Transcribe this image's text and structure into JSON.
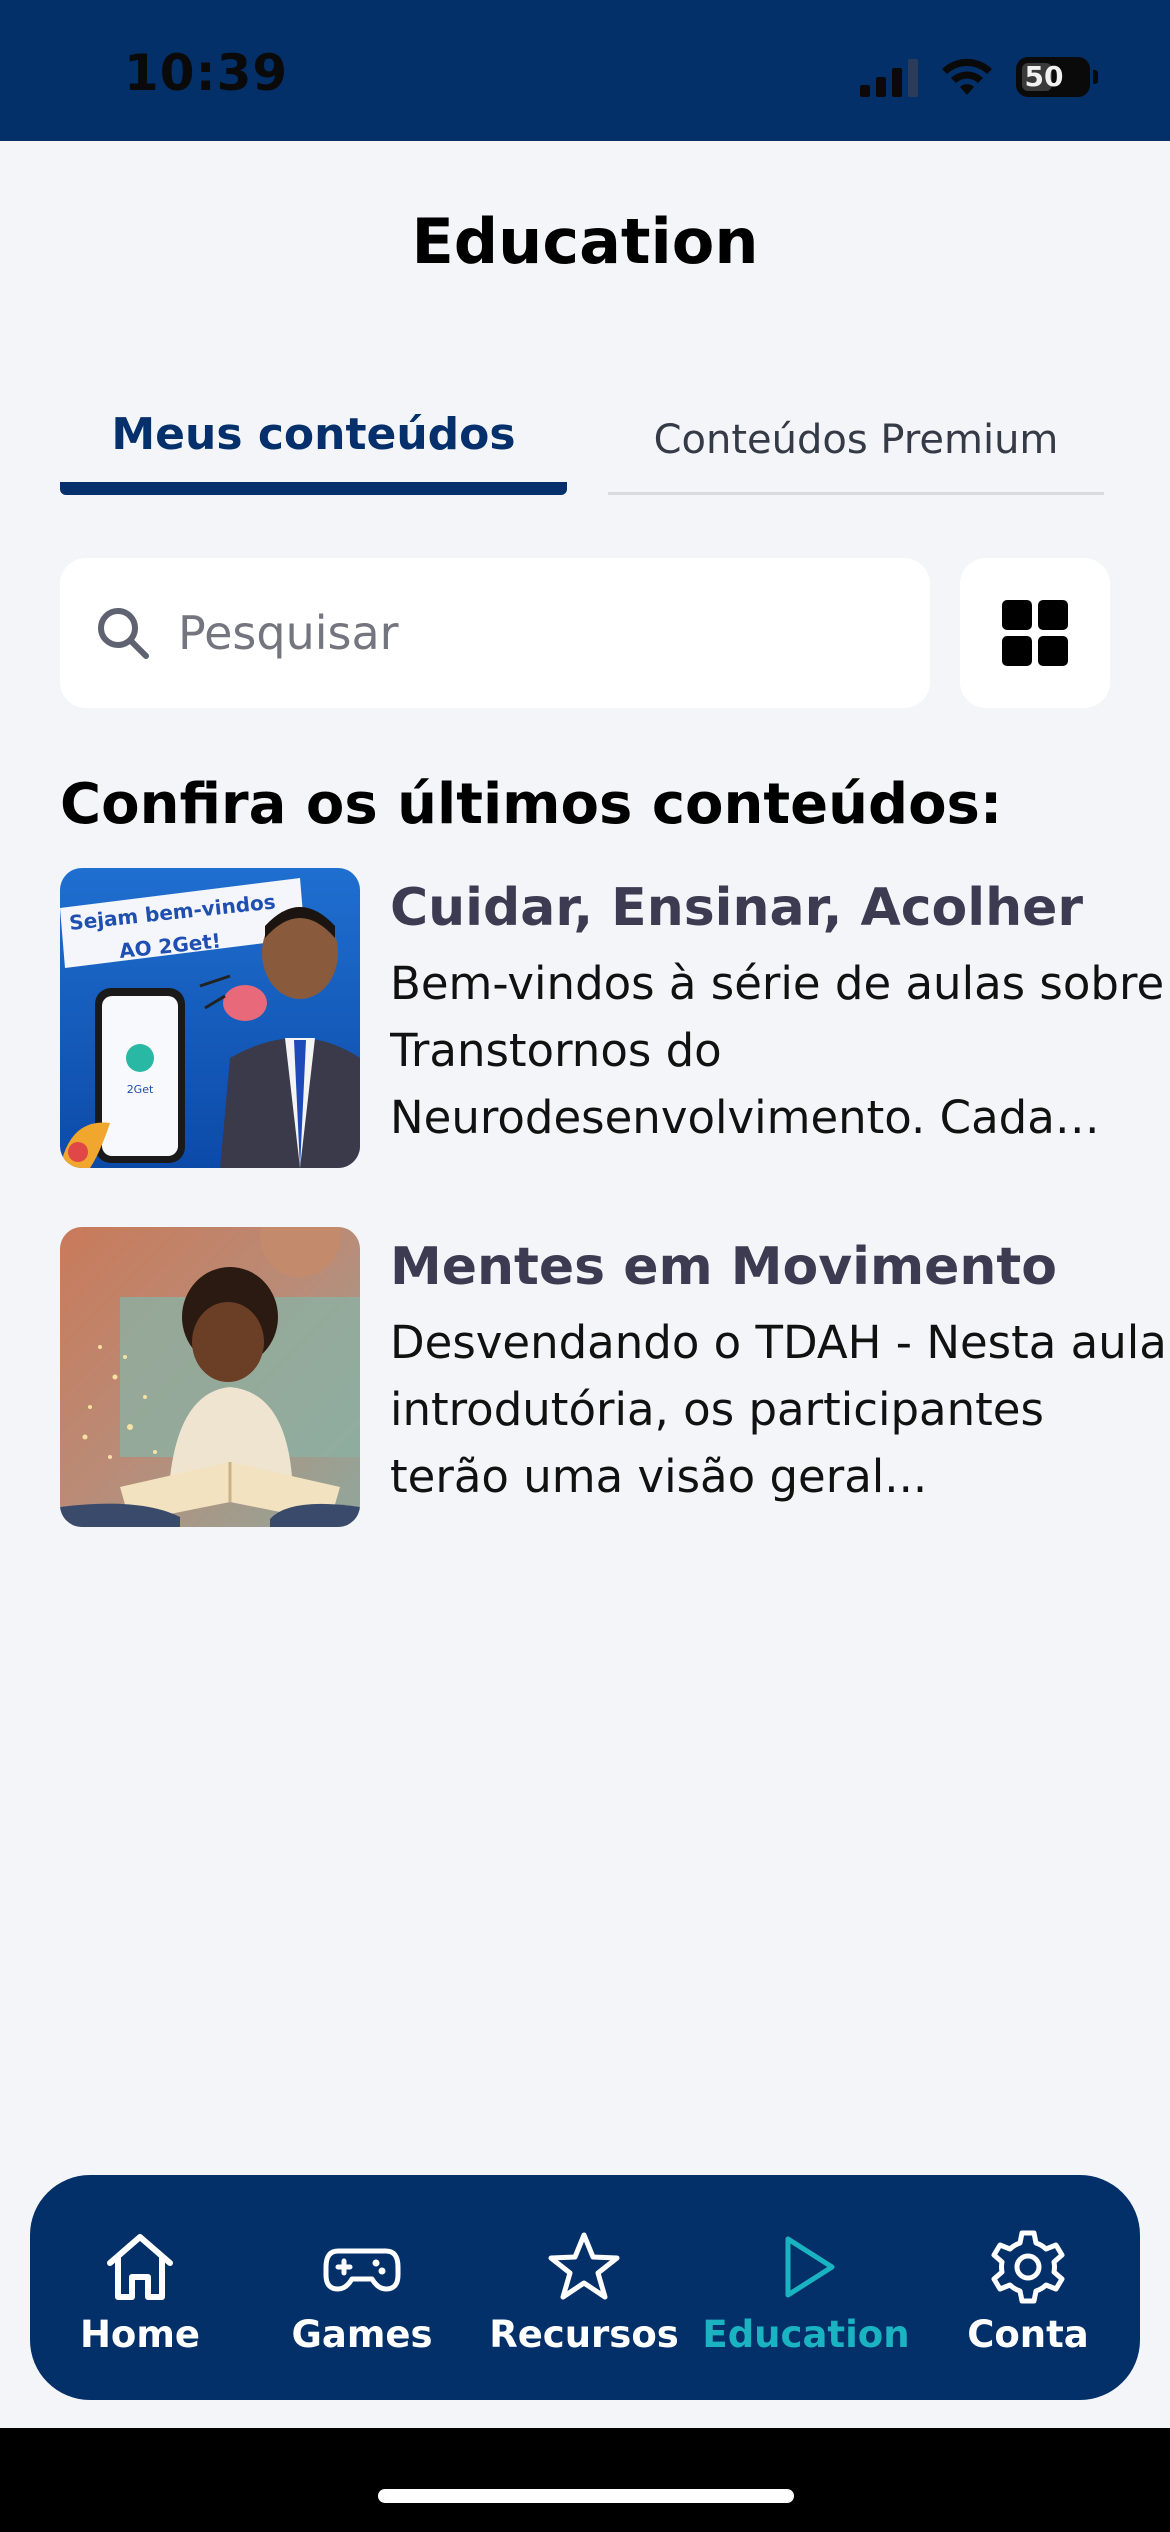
{
  "status_bar": {
    "time": "10:39",
    "battery": "50",
    "background_color": "#04306a"
  },
  "header": {
    "title": "Education"
  },
  "tabs": [
    {
      "label": "Meus conteúdos",
      "selected": true
    },
    {
      "label": "Conteúdos Premium",
      "selected": false
    }
  ],
  "search": {
    "placeholder": "Pesquisar",
    "value": "",
    "icon": "search-icon"
  },
  "view_toggle": {
    "icon": "grid-icon"
  },
  "content": {
    "heading": "Confira os últimos conteúdos:",
    "items": [
      {
        "title": "Cuidar, Ensinar, Acolher",
        "description": "Bem-vindos à série de aulas sobre Transtornos do Neurodesenvolvimento. Cada aula...",
        "thumbnail_banner_line1": "Sejam bem-vindos",
        "thumbnail_banner_line2": "AO 2Get!",
        "thumbnail_phone_text": "2Get"
      },
      {
        "title": "Mentes em Movimento",
        "description": "Desvendando o TDAH - Nesta aula introdutória, os participantes terão uma visão geral..."
      }
    ]
  },
  "bottom_nav": {
    "items": [
      {
        "label": "Home",
        "icon": "home-icon",
        "active": false
      },
      {
        "label": "Games",
        "icon": "gamepad-icon",
        "active": false
      },
      {
        "label": "Recursos",
        "icon": "star-icon",
        "active": false
      },
      {
        "label": "Education",
        "icon": "play-icon",
        "active": true
      },
      {
        "label": "Conta",
        "icon": "gear-icon",
        "active": false
      }
    ],
    "active_color": "#1ab3c2"
  }
}
